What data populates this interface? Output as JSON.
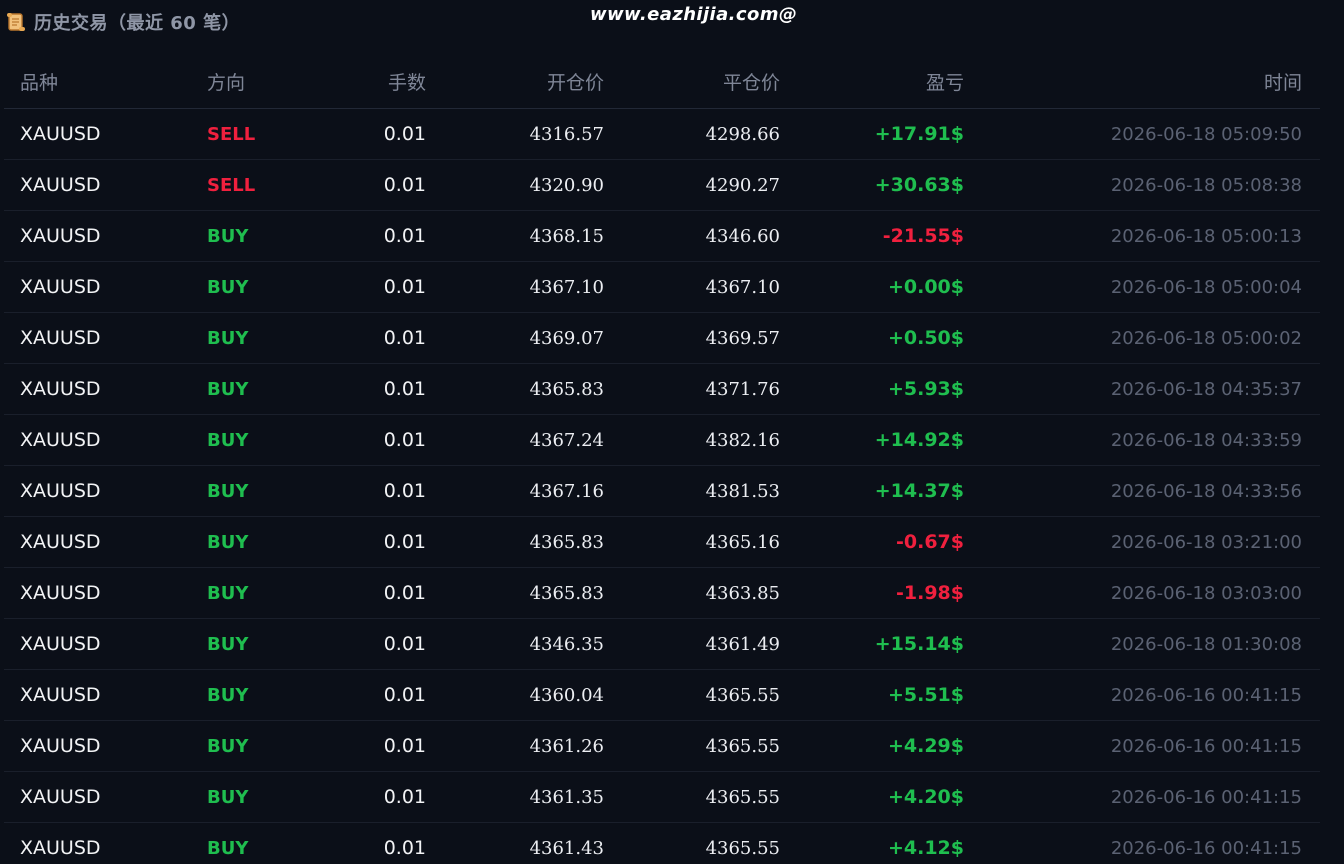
{
  "header": {
    "title": "历史交易（最近 60 笔）",
    "icon": "scroll-icon"
  },
  "watermark": "www.eazhijia.com@",
  "colors": {
    "background": "#0b0f18",
    "buy": "#1fbe4f",
    "sell": "#f0203e",
    "profit": "#1fbe4f",
    "loss": "#f0203e"
  },
  "table": {
    "columns": [
      "品种",
      "方向",
      "手数",
      "开仓价",
      "平仓价",
      "盈亏",
      "时间"
    ],
    "rows": [
      {
        "symbol": "XAUUSD",
        "direction": "SELL",
        "lots": "0.01",
        "open": "4316.57",
        "close": "4298.66",
        "pnl": "+17.91$",
        "time": "2026-06-18 05:09:50"
      },
      {
        "symbol": "XAUUSD",
        "direction": "SELL",
        "lots": "0.01",
        "open": "4320.90",
        "close": "4290.27",
        "pnl": "+30.63$",
        "time": "2026-06-18 05:08:38"
      },
      {
        "symbol": "XAUUSD",
        "direction": "BUY",
        "lots": "0.01",
        "open": "4368.15",
        "close": "4346.60",
        "pnl": "-21.55$",
        "time": "2026-06-18 05:00:13"
      },
      {
        "symbol": "XAUUSD",
        "direction": "BUY",
        "lots": "0.01",
        "open": "4367.10",
        "close": "4367.10",
        "pnl": "+0.00$",
        "time": "2026-06-18 05:00:04"
      },
      {
        "symbol": "XAUUSD",
        "direction": "BUY",
        "lots": "0.01",
        "open": "4369.07",
        "close": "4369.57",
        "pnl": "+0.50$",
        "time": "2026-06-18 05:00:02"
      },
      {
        "symbol": "XAUUSD",
        "direction": "BUY",
        "lots": "0.01",
        "open": "4365.83",
        "close": "4371.76",
        "pnl": "+5.93$",
        "time": "2026-06-18 04:35:37"
      },
      {
        "symbol": "XAUUSD",
        "direction": "BUY",
        "lots": "0.01",
        "open": "4367.24",
        "close": "4382.16",
        "pnl": "+14.92$",
        "time": "2026-06-18 04:33:59"
      },
      {
        "symbol": "XAUUSD",
        "direction": "BUY",
        "lots": "0.01",
        "open": "4367.16",
        "close": "4381.53",
        "pnl": "+14.37$",
        "time": "2026-06-18 04:33:56"
      },
      {
        "symbol": "XAUUSD",
        "direction": "BUY",
        "lots": "0.01",
        "open": "4365.83",
        "close": "4365.16",
        "pnl": "-0.67$",
        "time": "2026-06-18 03:21:00"
      },
      {
        "symbol": "XAUUSD",
        "direction": "BUY",
        "lots": "0.01",
        "open": "4365.83",
        "close": "4363.85",
        "pnl": "-1.98$",
        "time": "2026-06-18 03:03:00"
      },
      {
        "symbol": "XAUUSD",
        "direction": "BUY",
        "lots": "0.01",
        "open": "4346.35",
        "close": "4361.49",
        "pnl": "+15.14$",
        "time": "2026-06-18 01:30:08"
      },
      {
        "symbol": "XAUUSD",
        "direction": "BUY",
        "lots": "0.01",
        "open": "4360.04",
        "close": "4365.55",
        "pnl": "+5.51$",
        "time": "2026-06-16 00:41:15"
      },
      {
        "symbol": "XAUUSD",
        "direction": "BUY",
        "lots": "0.01",
        "open": "4361.26",
        "close": "4365.55",
        "pnl": "+4.29$",
        "time": "2026-06-16 00:41:15"
      },
      {
        "symbol": "XAUUSD",
        "direction": "BUY",
        "lots": "0.01",
        "open": "4361.35",
        "close": "4365.55",
        "pnl": "+4.20$",
        "time": "2026-06-16 00:41:15"
      },
      {
        "symbol": "XAUUSD",
        "direction": "BUY",
        "lots": "0.01",
        "open": "4361.43",
        "close": "4365.55",
        "pnl": "+4.12$",
        "time": "2026-06-16 00:41:15"
      }
    ]
  }
}
